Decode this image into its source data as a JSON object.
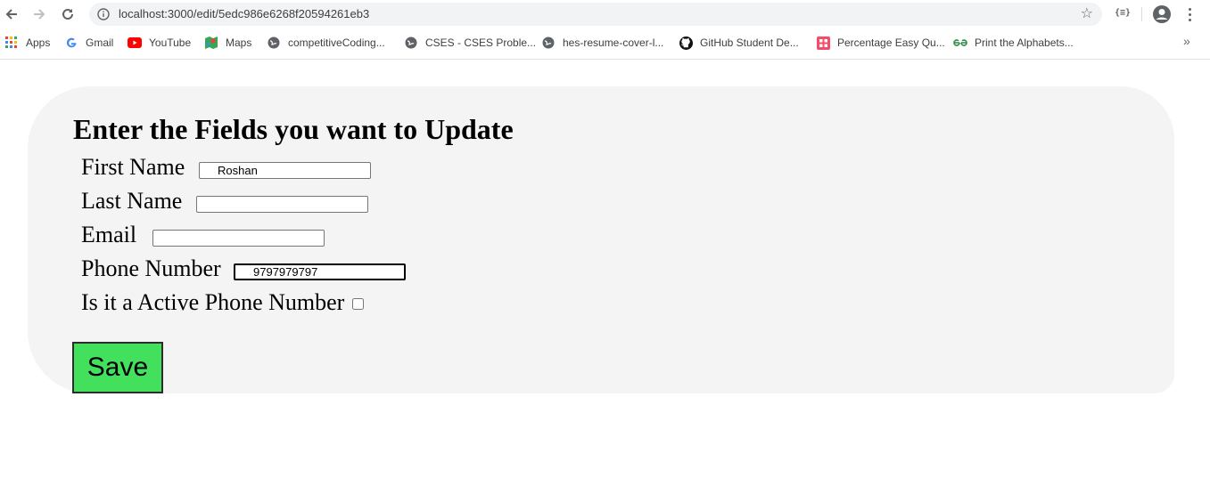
{
  "browser": {
    "url": "localhost:3000/edit/5edc986e6268f20594261eb3",
    "extension_label": "{≡}",
    "bookmarks": [
      {
        "label": "Apps",
        "icon": "apps-grid-icon"
      },
      {
        "label": "Gmail",
        "icon": "google-g-icon"
      },
      {
        "label": "YouTube",
        "icon": "youtube-icon"
      },
      {
        "label": "Maps",
        "icon": "maps-pin-icon"
      },
      {
        "label": "competitiveCoding...",
        "icon": "globe-icon"
      },
      {
        "label": "CSES - CSES Proble...",
        "icon": "globe-icon"
      },
      {
        "label": "hes-resume-cover-l...",
        "icon": "globe-icon"
      },
      {
        "label": "GitHub Student De...",
        "icon": "github-icon"
      },
      {
        "label": "Percentage Easy Qu...",
        "icon": "grid-pink-icon"
      },
      {
        "label": "Print the Alphabets...",
        "icon": "gfg-icon"
      }
    ],
    "more_label": "»"
  },
  "form": {
    "heading": "Enter the Fields you want to Update",
    "first_name_label": "First Name",
    "first_name_value": "Roshan",
    "last_name_label": "Last Name",
    "last_name_value": "",
    "email_label": "Email",
    "email_value": "",
    "phone_label": "Phone Number",
    "phone_value": "9797979797",
    "active_label": "Is it a Active Phone Number",
    "active_checked": false,
    "save_label": "Save"
  },
  "colors": {
    "panel_bg": "#f4f4f4",
    "save_button_bg": "#42e05d"
  }
}
